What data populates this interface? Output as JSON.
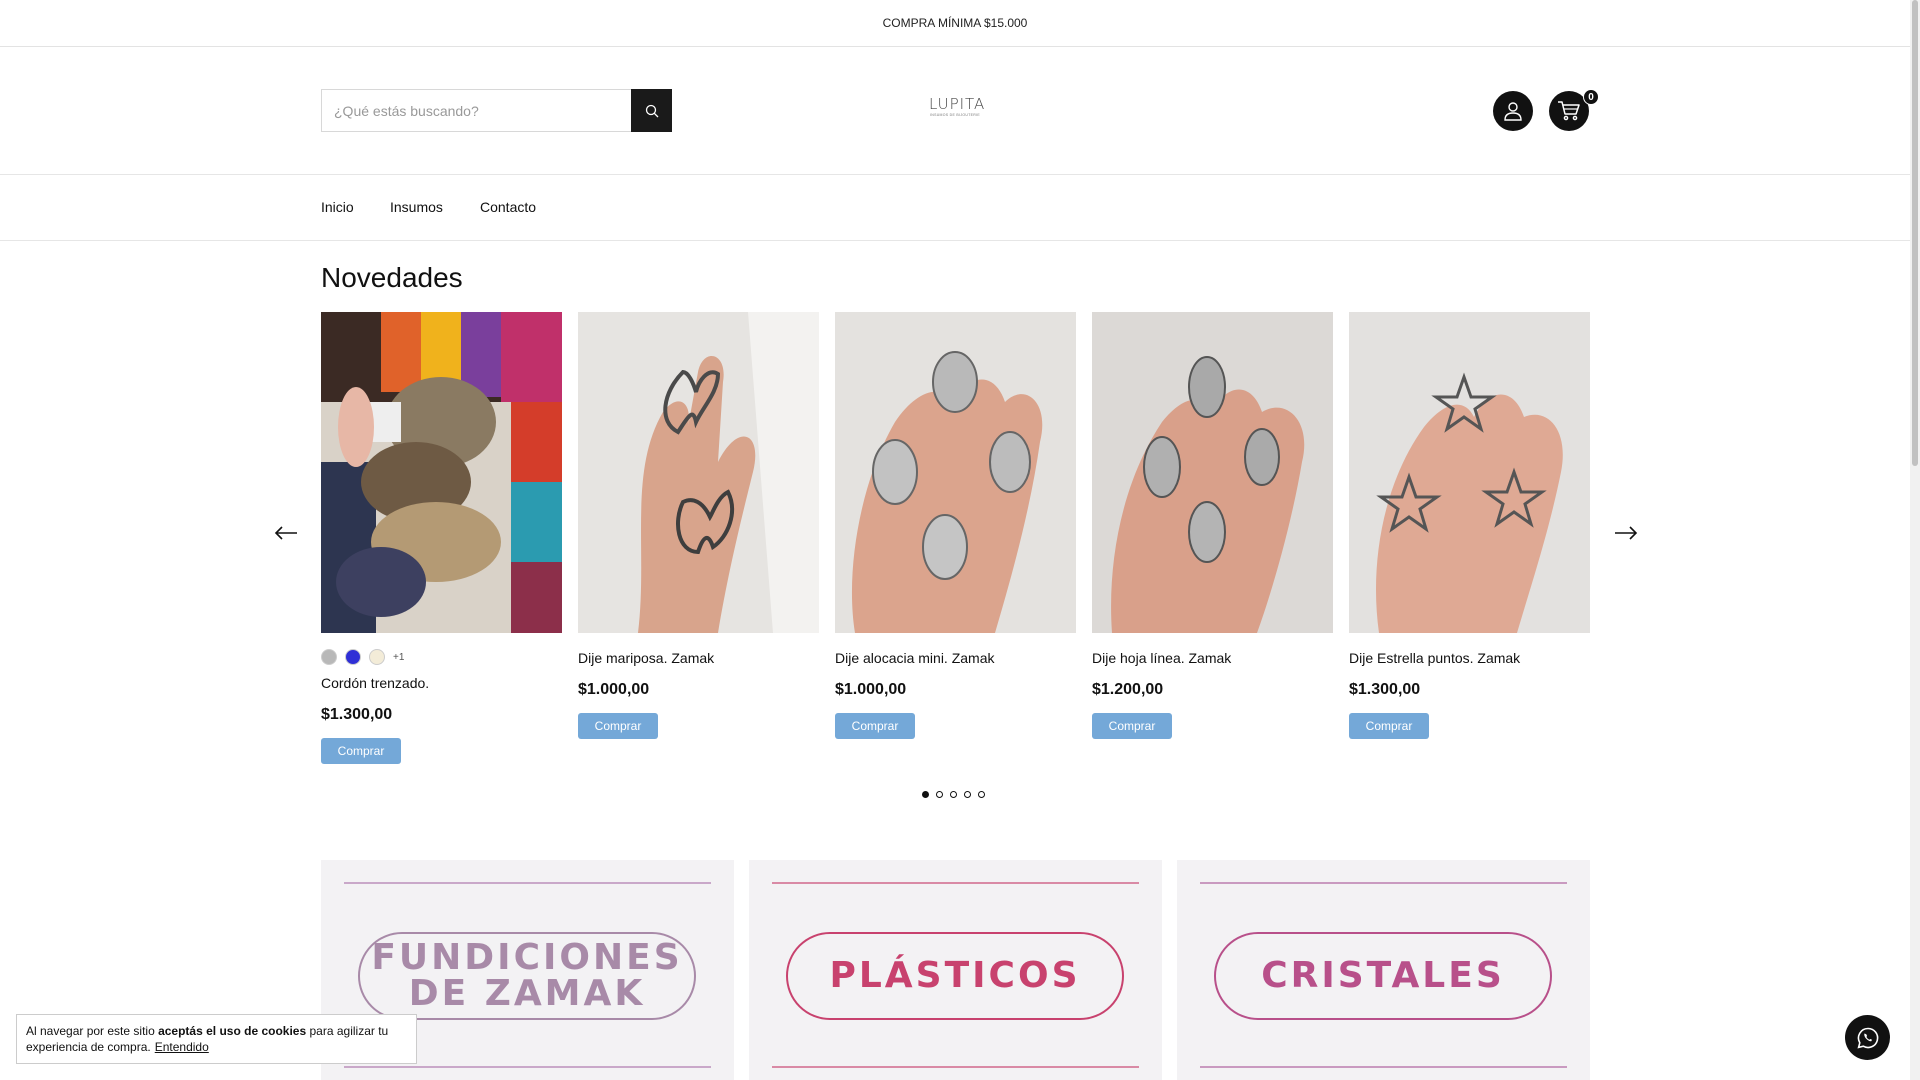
{
  "topbar": {
    "text": "COMPRA MÍNIMA $15.000"
  },
  "header": {
    "search_placeholder": "¿Qué estás buscando?",
    "logo_text": "LUPITA",
    "logo_subtext": "INSUMOS DE BIJOUTERIE",
    "cart_count": "0",
    "icons": {
      "search": "search-icon",
      "account": "user-icon",
      "cart": "cart-icon"
    }
  },
  "nav": {
    "items": [
      "Inicio",
      "Insumos",
      "Contacto"
    ]
  },
  "section": {
    "title": "Novedades"
  },
  "products": [
    {
      "name": "Cordón trenzado.",
      "price": "$1.300,00",
      "button": "Comprar",
      "more_colors": "+1",
      "swatches": [
        "#b8b8b8",
        "#2f2fd6",
        "#f3ecd8"
      ]
    },
    {
      "name": "Dije mariposa. Zamak",
      "price": "$1.000,00",
      "button": "Comprar"
    },
    {
      "name": "Dije alocacia mini. Zamak",
      "price": "$1.000,00",
      "button": "Comprar"
    },
    {
      "name": "Dije hoja línea. Zamak",
      "price": "$1.200,00",
      "button": "Comprar"
    },
    {
      "name": "Dije Estrella puntos. Zamak",
      "price": "$1.300,00",
      "button": "Comprar"
    }
  ],
  "carousel": {
    "pages": 5,
    "active": 1
  },
  "banners": [
    {
      "line1": "FUNDICIONES",
      "line2": "DE ZAMAK",
      "color": "#a88aa8",
      "rule": "#c9a8c9"
    },
    {
      "line1": "PLÁSTICOS",
      "line2": "",
      "color": "#c8426e",
      "rule": "#d98aa5"
    },
    {
      "line1": "CRISTALES",
      "line2": "",
      "color": "#b8508a",
      "rule": "#c99ac0"
    }
  ],
  "cookie": {
    "text_before": "Al navegar por este sitio ",
    "text_bold": "aceptás el uso de cookies",
    "text_after": " para agilizar tu experiencia de compra.",
    "link": "Entendido"
  },
  "colors": {
    "accent_button": "#74a8d8",
    "dark": "#111111"
  }
}
